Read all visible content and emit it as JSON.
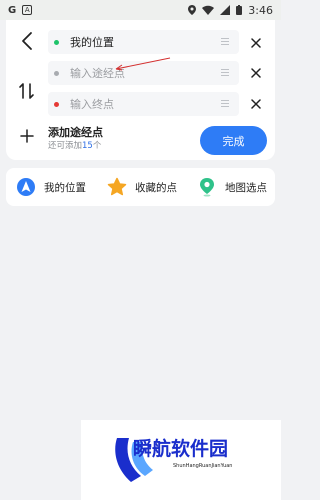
{
  "status_bar": {
    "time": "3:46"
  },
  "route": {
    "fields": [
      {
        "text": "我的位置",
        "is_placeholder": false,
        "dot_color": "#1fc36a"
      },
      {
        "text": "输入途经点",
        "is_placeholder": true,
        "dot_color": "#a8abb0"
      },
      {
        "text": "输入终点",
        "is_placeholder": true,
        "dot_color": "#e53935"
      }
    ],
    "add_stop_title": "添加途经点",
    "add_stop_sub_prefix": "还可添加",
    "add_stop_count": "15",
    "add_stop_sub_suffix": "个",
    "done_label": "完成"
  },
  "quick_options": [
    {
      "label": "我的位置",
      "icon": "navigation-arrow-icon"
    },
    {
      "label": "收藏的点",
      "icon": "star-icon"
    },
    {
      "label": "地图选点",
      "icon": "map-pin-icon"
    }
  ],
  "watermark": {
    "title": "瞬航软件园",
    "subtitle": "ShunHangRuanJianYuan"
  },
  "colors": {
    "accent": "#2e7cf6",
    "star": "#f5a623",
    "pin": "#2fc28a"
  }
}
